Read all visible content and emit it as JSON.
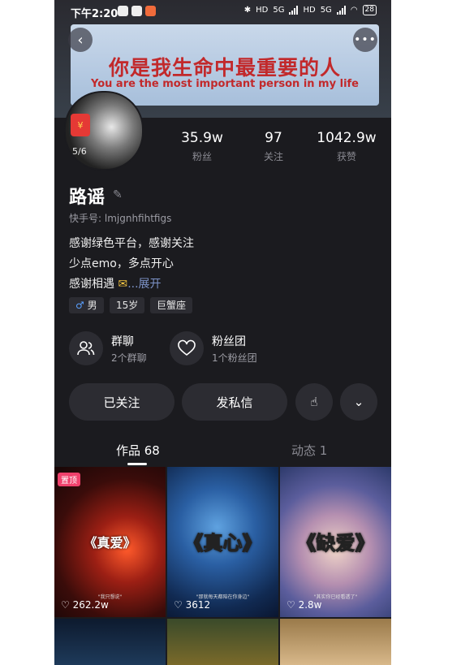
{
  "status_bar": {
    "time": "下午2:20",
    "hd1": "HD",
    "net1": "5G",
    "hd2": "HD",
    "net2": "5G",
    "battery": "28"
  },
  "banner": {
    "text_cn": "你是我生命中最重要的人",
    "text_en": "You are the most important person in my life"
  },
  "header": {
    "back_icon": "chevron-left-icon",
    "more_icon": "more-dots-icon",
    "more_label": "•••"
  },
  "profile": {
    "avatar_count": "5/6",
    "name": "路谣",
    "uid": "快手号: lmjgnhfihtfigs",
    "bio": [
      "感谢绿色平台，感谢关注",
      "少点emo，多点开心",
      "感谢相遇"
    ],
    "bio_more": "...展开",
    "tags": {
      "gender_symbol": "♂",
      "gender": "男",
      "age": "15岁",
      "zodiac": "巨蟹座"
    }
  },
  "stats": [
    {
      "num": "35.9w",
      "label": "粉丝"
    },
    {
      "num": "97",
      "label": "关注"
    },
    {
      "num": "1042.9w",
      "label": "获赞"
    }
  ],
  "groups": {
    "chat": {
      "title": "群聊",
      "sub": "2个群聊"
    },
    "fans": {
      "title": "粉丝团",
      "sub": "1个粉丝团"
    }
  },
  "actions": {
    "followed": "已关注",
    "message": "发私信"
  },
  "tabs": {
    "works": "作品 68",
    "dynamic": "动态 1"
  },
  "posts": [
    {
      "title": "《真爱》",
      "caption": "\"我只想说\"",
      "likes": "262.2w",
      "badge": "置顶"
    },
    {
      "title": "《真心》",
      "caption": "\"那就每天都陪在你身边\"",
      "likes": "3612"
    },
    {
      "title": "《缺爱》",
      "caption": "\"其实你已经看透了\"",
      "likes": "2.8w"
    }
  ],
  "colors": {
    "background": "#1b1b1f",
    "accent_link": "#7d93c8",
    "pin_badge": "#f0416c",
    "banner_text": "#c2292b"
  }
}
